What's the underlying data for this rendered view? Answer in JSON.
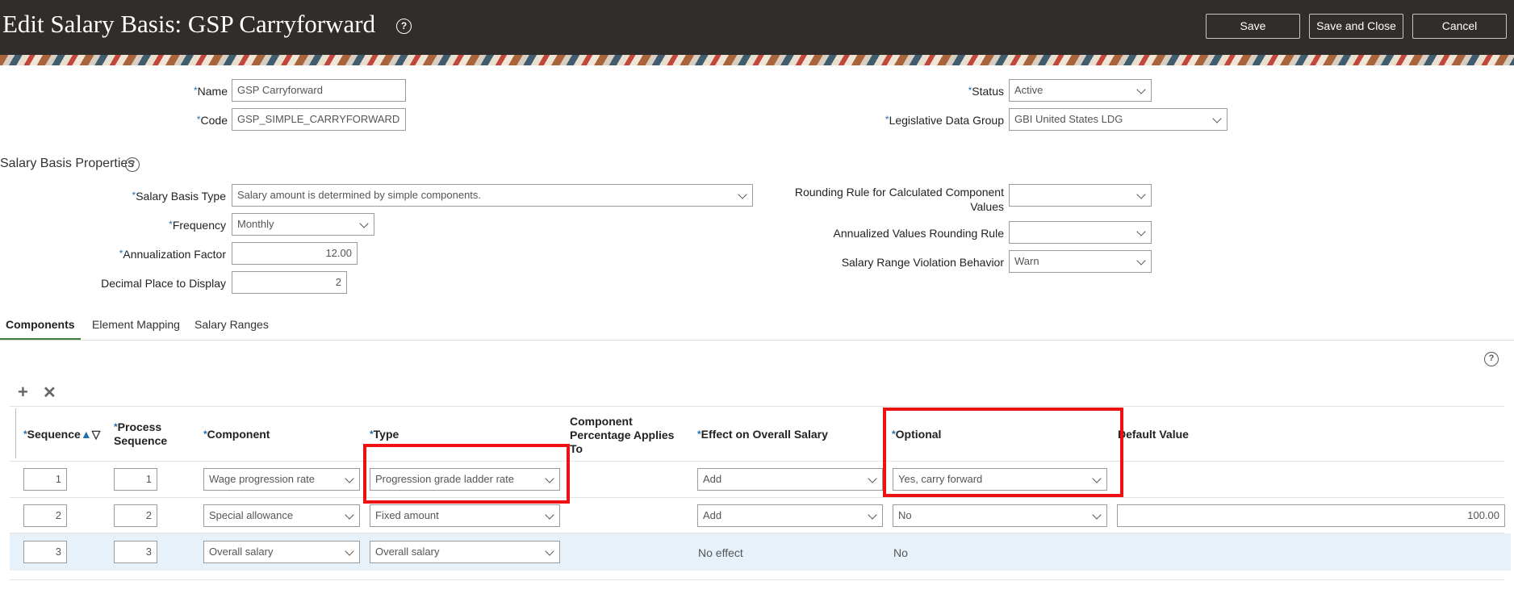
{
  "header": {
    "title": "Edit Salary Basis: GSP Carryforward",
    "save_label": "Save",
    "save_close_label": "Save and Close",
    "cancel_label": "Cancel"
  },
  "form": {
    "name_label": "Name",
    "name_value": "GSP Carryforward",
    "code_label": "Code",
    "code_value": "GSP_SIMPLE_CARRYFORWARD",
    "status_label": "Status",
    "status_value": "Active",
    "ldg_label": "Legislative Data Group",
    "ldg_value": "GBI United States LDG"
  },
  "properties": {
    "section_title": "Salary Basis Properties",
    "type_label": "Salary Basis Type",
    "type_value": "Salary amount is determined by simple components.",
    "frequency_label": "Frequency",
    "frequency_value": "Monthly",
    "annualization_label": "Annualization Factor",
    "annualization_value": "12.00",
    "decimal_label": "Decimal Place to Display",
    "decimal_value": "2",
    "rounding_label_1": "Rounding Rule for Calculated Component",
    "rounding_label_2": "Values",
    "rounding_value": "",
    "annualized_label": "Annualized Values Rounding Rule",
    "annualized_value": "",
    "violation_label": "Salary Range Violation Behavior",
    "violation_value": "Warn"
  },
  "tabs": [
    "Components",
    "Element Mapping",
    "Salary Ranges"
  ],
  "table": {
    "headers": {
      "sequence": "Sequence",
      "process_1": "Process",
      "process_2": "Sequence",
      "component": "Component",
      "type": "Type",
      "pct_1": "Component",
      "pct_2": "Percentage Applies",
      "pct_3": "To",
      "effect": "Effect on Overall Salary",
      "optional": "Optional",
      "default": "Default Value"
    },
    "rows": [
      {
        "seq": "1",
        "proc": "1",
        "component": "Wage progression rate",
        "type": "Progression grade ladder rate",
        "effect": "Add",
        "optional": "Yes, carry forward",
        "default": ""
      },
      {
        "seq": "2",
        "proc": "2",
        "component": "Special allowance",
        "type": "Fixed amount",
        "effect": "Add",
        "optional": "No",
        "default": "100.00"
      },
      {
        "seq": "3",
        "proc": "3",
        "component": "Overall salary",
        "type": "Overall salary",
        "effect": "No effect",
        "optional": "No",
        "default": ""
      }
    ]
  },
  "icons": {
    "add": "plus-icon",
    "delete": "x-icon",
    "help": "question-icon"
  },
  "colors": {
    "header_bg": "#312d2a",
    "required": "#1f6fb2",
    "highlight": "#ee1111",
    "selected_row": "#e6f1fa",
    "active_tab": "#3f7d3f"
  }
}
